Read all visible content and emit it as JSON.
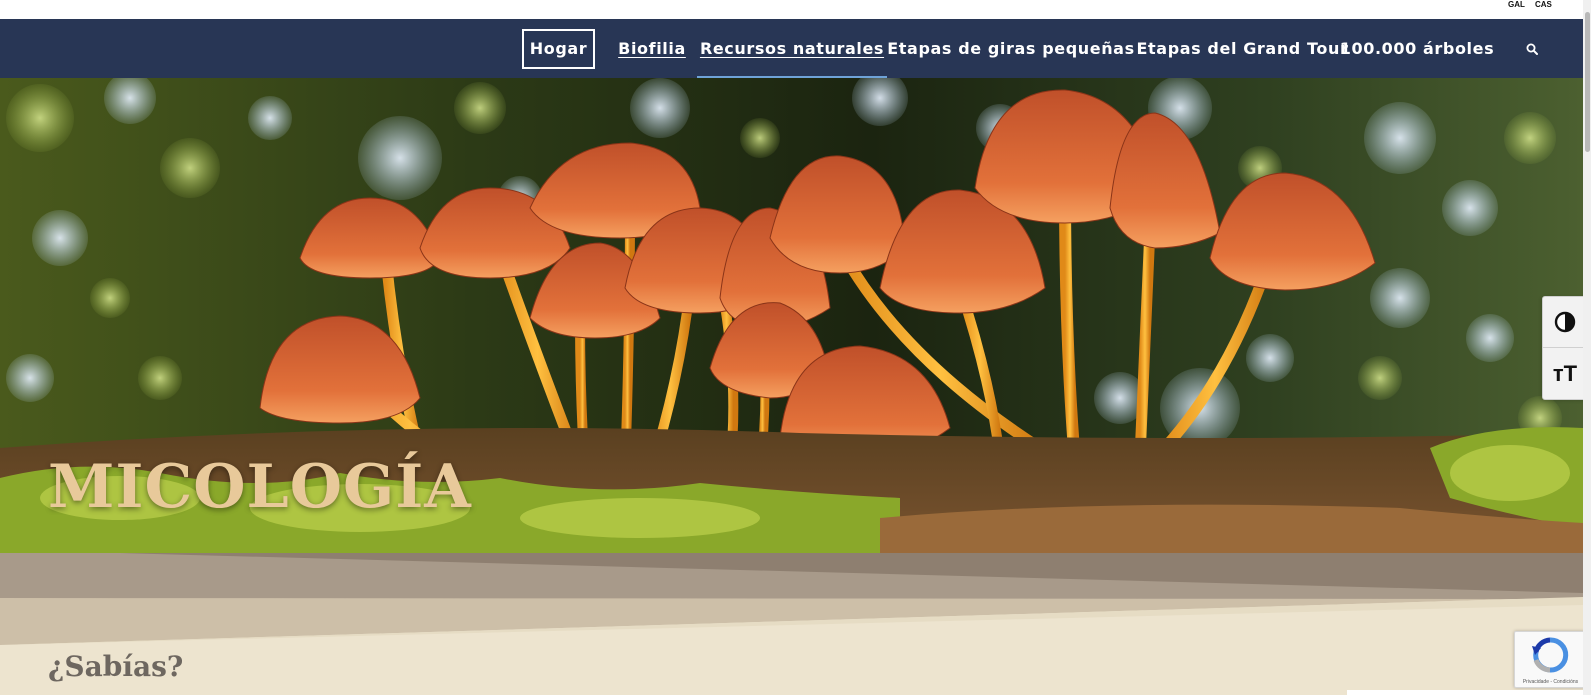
{
  "language_bar": {
    "gal": "GAL",
    "cas": "CAS"
  },
  "nav": {
    "items": [
      {
        "label": "Hogar",
        "state": "boxed"
      },
      {
        "label": "Biofilia",
        "state": "underlined"
      },
      {
        "label": "Recursos naturales",
        "state": "active"
      },
      {
        "label": "Etapas de giras pequeñas"
      },
      {
        "label": "Etapas del Grand Tour"
      },
      {
        "label": "100.000 árboles"
      }
    ],
    "search_icon": "search-icon"
  },
  "hero": {
    "title": "MICOLOGÍA",
    "image": "orange mushrooms on a mossy log, forest bokeh background"
  },
  "section": {
    "heading": "¿Sabías?"
  },
  "accessibility": {
    "contrast_icon": "contrast-icon",
    "font_size_label": "тT"
  },
  "recaptcha": {
    "label": "Privacidade - Condicións"
  },
  "colors": {
    "nav_bg": "#283655",
    "active_underline": "#6fa3d8",
    "hero_title": "#e8c99a",
    "band_dark": "#a89a8a",
    "band_light": "#ede4cf"
  }
}
